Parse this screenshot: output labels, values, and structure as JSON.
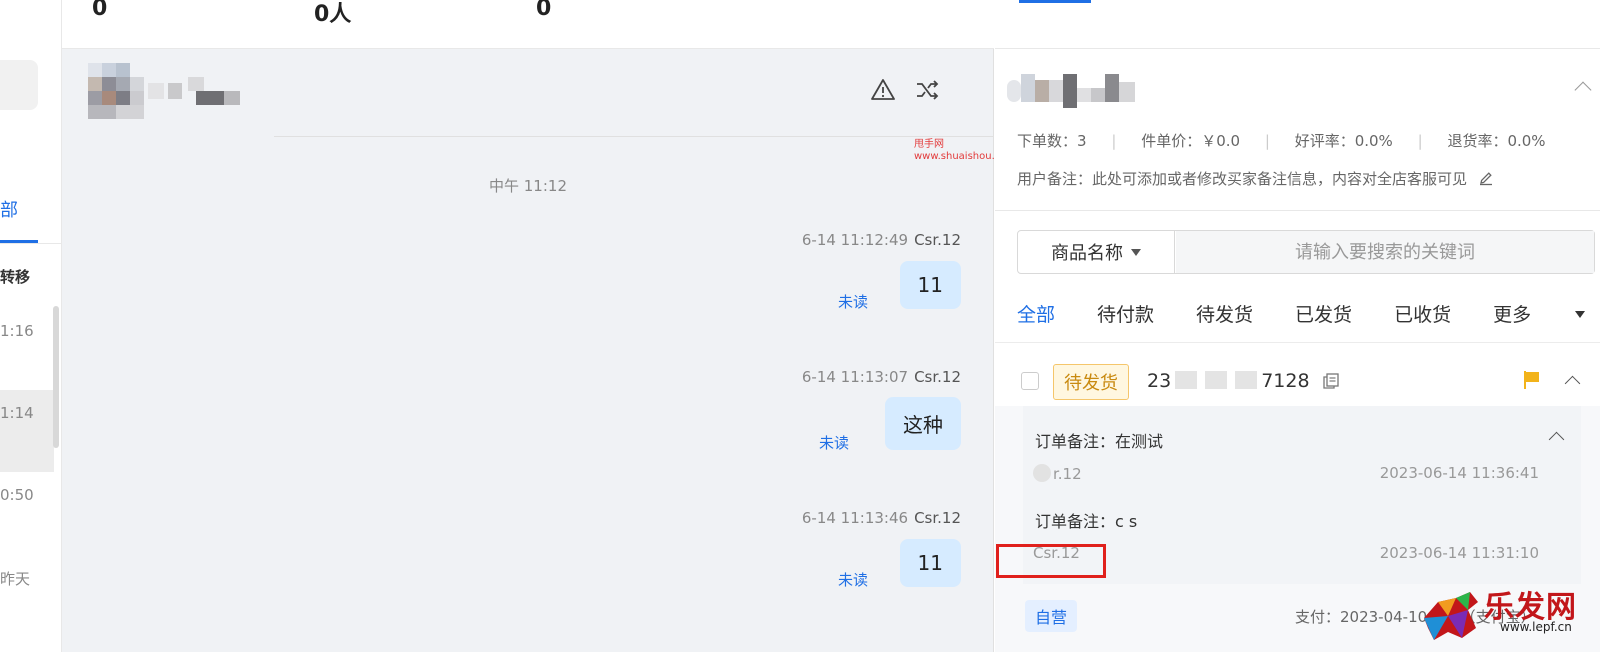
{
  "left_list": {
    "tab_label": "部",
    "transfer_label": "转移",
    "times": [
      "1:16",
      "1:14",
      "0:50",
      "昨天"
    ]
  },
  "stats_bar": {
    "values": [
      "0",
      "0人",
      "0"
    ]
  },
  "chat": {
    "watermark": {
      "line1": "甩手网",
      "line2": "www.shuaishou.com"
    },
    "time_divider": "中午 11:12",
    "messages": [
      {
        "time": "6-14 11:12:49",
        "sender": "Csr.12",
        "text": "11",
        "status": "未读"
      },
      {
        "time": "6-14 11:13:07",
        "sender": "Csr.12",
        "text": "这种",
        "status": "未读"
      },
      {
        "time": "6-14 11:13:46",
        "sender": "Csr.12",
        "text": "11",
        "status": "未读"
      }
    ]
  },
  "customer": {
    "stats": [
      {
        "label": "下单数：",
        "value": "3"
      },
      {
        "label": "件单价：",
        "value": "￥0.0"
      },
      {
        "label": "好评率：",
        "value": "0.0%"
      },
      {
        "label": "退货率：",
        "value": "0.0%"
      }
    ],
    "remark_label": "用户备注：",
    "remark_text": "此处可添加或者修改买家备注信息，内容对全店客服可见"
  },
  "search": {
    "select_label": "商品名称",
    "placeholder": "请输入要搜索的关键词"
  },
  "order_tabs": [
    "全部",
    "待付款",
    "待发货",
    "已发货",
    "已收货",
    "更多"
  ],
  "order": {
    "status_badge": "待发货",
    "number_prefix": "23",
    "number_suffix": "7128",
    "remarks": [
      {
        "label": "订单备注：在测试",
        "author": "r.12",
        "time": "2023-06-14 11:36:41"
      },
      {
        "label": "订单备注：c s",
        "author": "Csr.12",
        "time": "2023-06-14 11:31:10"
      }
    ],
    "type_badge": "自营",
    "payment_text": "支付：2023-04-10 2",
    "payment_tail": "40（支付宝）"
  },
  "corner_logo": {
    "title": "乐发网",
    "url": "www.lepf.cn"
  },
  "colors": {
    "accent": "#1f6fe5",
    "bubble": "#d6ebff",
    "pending": "#c98a10",
    "highlight_box": "#e0201c"
  }
}
